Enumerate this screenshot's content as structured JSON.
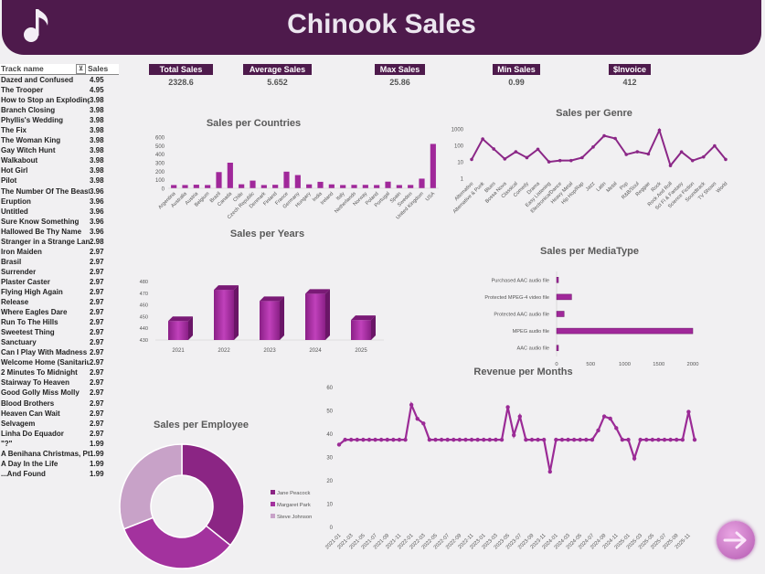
{
  "header": {
    "title": "Chinook Sales",
    "logo_icon": "music-note-icon"
  },
  "kpis": [
    {
      "label": "Total Sales",
      "value": "2328.6"
    },
    {
      "label": "Average Sales",
      "value": "5.652"
    },
    {
      "label": "Max Sales",
      "value": "25.86"
    },
    {
      "label": "Min Sales",
      "value": "0.99"
    },
    {
      "label": "$Invoice",
      "value": "412"
    }
  ],
  "tracks": {
    "col_name": "Track name",
    "col_sales": "Sales",
    "rows": [
      [
        "Dazed and Confused",
        "4.95"
      ],
      [
        "The Trooper",
        "4.95"
      ],
      [
        "How to Stop an Exploding",
        "3.98"
      ],
      [
        "Branch Closing",
        "3.98"
      ],
      [
        "Phyllis's Wedding",
        "3.98"
      ],
      [
        "The Fix",
        "3.98"
      ],
      [
        "The Woman King",
        "3.98"
      ],
      [
        "Gay Witch Hunt",
        "3.98"
      ],
      [
        "Walkabout",
        "3.98"
      ],
      [
        "Hot Girl",
        "3.98"
      ],
      [
        "Pilot",
        "3.98"
      ],
      [
        "The Number Of The Beast",
        "3.96"
      ],
      [
        "Eruption",
        "3.96"
      ],
      [
        "Untitled",
        "3.96"
      ],
      [
        "Sure Know Something",
        "3.96"
      ],
      [
        "Hallowed Be Thy Name",
        "3.96"
      ],
      [
        "Stranger in a Strange Land",
        "2.98"
      ],
      [
        "Iron Maiden",
        "2.97"
      ],
      [
        "Brasil",
        "2.97"
      ],
      [
        "Surrender",
        "2.97"
      ],
      [
        "Plaster Caster",
        "2.97"
      ],
      [
        "Flying High Again",
        "2.97"
      ],
      [
        "Release",
        "2.97"
      ],
      [
        "Where Eagles Dare",
        "2.97"
      ],
      [
        "Run To The Hills",
        "2.97"
      ],
      [
        "Sweetest Thing",
        "2.97"
      ],
      [
        "Sanctuary",
        "2.97"
      ],
      [
        "Can I Play With Madness",
        "2.97"
      ],
      [
        "Welcome Home (Sanitarium",
        "2.97"
      ],
      [
        "2 Minutes To Midnight",
        "2.97"
      ],
      [
        "Stairway To Heaven",
        "2.97"
      ],
      [
        "Good Golly Miss Molly",
        "2.97"
      ],
      [
        "Blood Brothers",
        "2.97"
      ],
      [
        "Heaven Can Wait",
        "2.97"
      ],
      [
        "Selvagem",
        "2.97"
      ],
      [
        "Linha Do Equador",
        "2.97"
      ],
      [
        "\"?\"",
        "1.99"
      ],
      [
        "A Benihana Christmas, Pts",
        "1.99"
      ],
      [
        "A Day In the Life",
        "1.99"
      ],
      [
        "...And Found",
        "1.99"
      ]
    ]
  },
  "chart_data": [
    {
      "type": "bar",
      "title": "Sales per Countries",
      "categories": [
        "Argentina",
        "Australia",
        "Austria",
        "Belgium",
        "Brazil",
        "Canada",
        "Chile",
        "Czech Republic",
        "Denmark",
        "Finland",
        "France",
        "Germany",
        "Hungary",
        "India",
        "Ireland",
        "Italy",
        "Netherlands",
        "Norway",
        "Poland",
        "Portugal",
        "Spain",
        "Sweden",
        "United Kingdom",
        "USA"
      ],
      "values": [
        38,
        38,
        42,
        38,
        190,
        300,
        47,
        90,
        38,
        41,
        195,
        155,
        46,
        76,
        46,
        38,
        40,
        40,
        38,
        78,
        38,
        39,
        113,
        520
      ],
      "ylim": [
        0,
        600
      ],
      "yticks": [
        "0",
        "100",
        "200",
        "300",
        "400",
        "500",
        "600"
      ],
      "color": "#a0289a"
    },
    {
      "type": "line",
      "title": "Sales per Genre",
      "categories": [
        "Alternative",
        "Alternative & Punk",
        "Blues",
        "Bossa Nova",
        "Classical",
        "Comedy",
        "Drama",
        "Easy Listening",
        "Electronica/Dance",
        "Heavy Metal",
        "Hip Hop/Rap",
        "Jazz",
        "Latin",
        "Metal",
        "Pop",
        "R&B/Soul",
        "Reggae",
        "Rock",
        "Rock And Roll",
        "Sci Fi & Fantasy",
        "Science Fiction",
        "Soundtrack",
        "TV Shows",
        "World"
      ],
      "values": [
        13.9,
        241.6,
        60.4,
        14.9,
        40.6,
        17.9,
        57.7,
        9.9,
        11.9,
        11.9,
        17.8,
        79.2,
        382.1,
        261.4,
        27.7,
        40.6,
        29.7,
        826.6,
        5.9,
        39.8,
        11.9,
        19.8,
        93.5,
        13.9
      ],
      "log_scale": true,
      "yticks": [
        "1",
        "10",
        "100",
        "1000"
      ],
      "color": "#8b2787"
    },
    {
      "type": "bar",
      "title": "Sales per Years",
      "categories": [
        "2021",
        "2022",
        "2023",
        "2024",
        "2025"
      ],
      "values": [
        449.5,
        481.5,
        470,
        477.5,
        450.5
      ],
      "ylim": [
        430,
        490
      ],
      "yticks": [
        "480",
        "470",
        "460",
        "450",
        "440",
        "430"
      ],
      "y_axis_reversed_labels": true,
      "color": "#a0289a"
    },
    {
      "type": "bar",
      "orientation": "horizontal",
      "title": "Sales per MediaType",
      "categories": [
        "Purchased AAC audio file",
        "Protected MPEG-4 video file",
        "Protected AAC audio file",
        "MPEG audio file",
        "AAC audio file"
      ],
      "values": [
        3.96,
        220,
        110,
        2000,
        7.9
      ],
      "xlim": [
        0,
        2000
      ],
      "xticks": [
        "0",
        "500",
        "1000",
        "1500",
        "2000"
      ],
      "color": "#a0289a"
    },
    {
      "type": "pie",
      "title": "Sales per Employee",
      "categories": [
        "Jane Peacock",
        "Margaret Park",
        "Steve Johnson"
      ],
      "values": [
        833.04,
        775.4,
        720.16
      ],
      "colors": [
        "#8b2584",
        "#a3329e",
        "#c8a2c8"
      ]
    },
    {
      "type": "line",
      "title": "Revenue per Months",
      "x": [
        "2021-01",
        "2021-02",
        "2021-03",
        "2021-04",
        "2021-05",
        "2021-06",
        "2021-07",
        "2021-08",
        "2021-09",
        "2021-10",
        "2021-11",
        "2021-12",
        "2022-01",
        "2022-02",
        "2022-03",
        "2022-04",
        "2022-05",
        "2022-06",
        "2022-07",
        "2022-08",
        "2022-09",
        "2022-10",
        "2022-11",
        "2022-12",
        "2023-01",
        "2023-02",
        "2023-03",
        "2023-04",
        "2023-05",
        "2023-06",
        "2023-07",
        "2023-08",
        "2023-09",
        "2023-10",
        "2023-11",
        "2023-12",
        "2024-01",
        "2024-02",
        "2024-03",
        "2024-04",
        "2024-05",
        "2024-06",
        "2024-07",
        "2024-08",
        "2024-09",
        "2024-10",
        "2024-11",
        "2024-12",
        "2025-01",
        "2025-02",
        "2025-03",
        "2025-04",
        "2025-05",
        "2025-06",
        "2025-07",
        "2025-08",
        "2025-09",
        "2025-10",
        "2025-11",
        "2025-12"
      ],
      "xtick_labels": [
        "2021-01",
        "2021-03",
        "2021-05",
        "2021-07",
        "2021-09",
        "2021-11",
        "2022-01",
        "2022-03",
        "2022-05",
        "2022-07",
        "2022-09",
        "2022-11",
        "2023-01",
        "2023-03",
        "2023-05",
        "2023-07",
        "2023-09",
        "2023-11",
        "2024-01",
        "2024-03",
        "2024-05",
        "2024-07",
        "2024-09",
        "2024-11",
        "2025-01",
        "2025-03",
        "2025-05",
        "2025-07",
        "2025-09",
        "2025-11"
      ],
      "values": [
        35.5,
        37.6,
        37.6,
        37.6,
        37.6,
        37.6,
        37.6,
        37.6,
        37.6,
        37.6,
        37.6,
        37.6,
        52.6,
        46.6,
        44.6,
        37.6,
        37.6,
        37.6,
        37.6,
        37.6,
        37.6,
        37.6,
        37.6,
        37.6,
        37.6,
        37.6,
        37.6,
        37.6,
        51.6,
        39.6,
        47.6,
        37.6,
        37.6,
        37.6,
        37.6,
        23.9,
        37.6,
        37.6,
        37.6,
        37.6,
        37.6,
        37.6,
        37.6,
        41.6,
        47.6,
        46.7,
        42.6,
        37.6,
        37.6,
        29.6,
        37.6,
        37.6,
        37.6,
        37.6,
        37.6,
        37.6,
        37.6,
        37.6,
        49.6,
        37.6
      ],
      "ylim": [
        0,
        60
      ],
      "yticks": [
        "0",
        "10",
        "20",
        "30",
        "40",
        "50",
        "60"
      ],
      "color": "#9b2b96"
    }
  ],
  "nav": {
    "next_icon": "arrow-right-icon"
  }
}
